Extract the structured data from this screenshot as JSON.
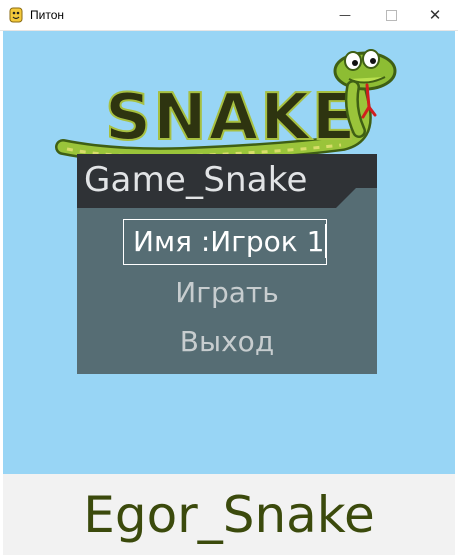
{
  "window": {
    "title": "Питон",
    "minimize_glyph": "—",
    "close_glyph": "✕"
  },
  "logo": {
    "text": "SNAKE"
  },
  "menu": {
    "title": "Game_Snake",
    "name_field_value": "Имя :Игрок 1",
    "play_label": "Играть",
    "exit_label": "Выход"
  },
  "footer": {
    "text": "Egor_Snake"
  },
  "colors": {
    "background": "#98d5f5",
    "panel_header": "#2f3236",
    "panel_body": "#566d74",
    "footer_bg": "#f2f2f2",
    "footer_text": "#3b4a0c"
  }
}
